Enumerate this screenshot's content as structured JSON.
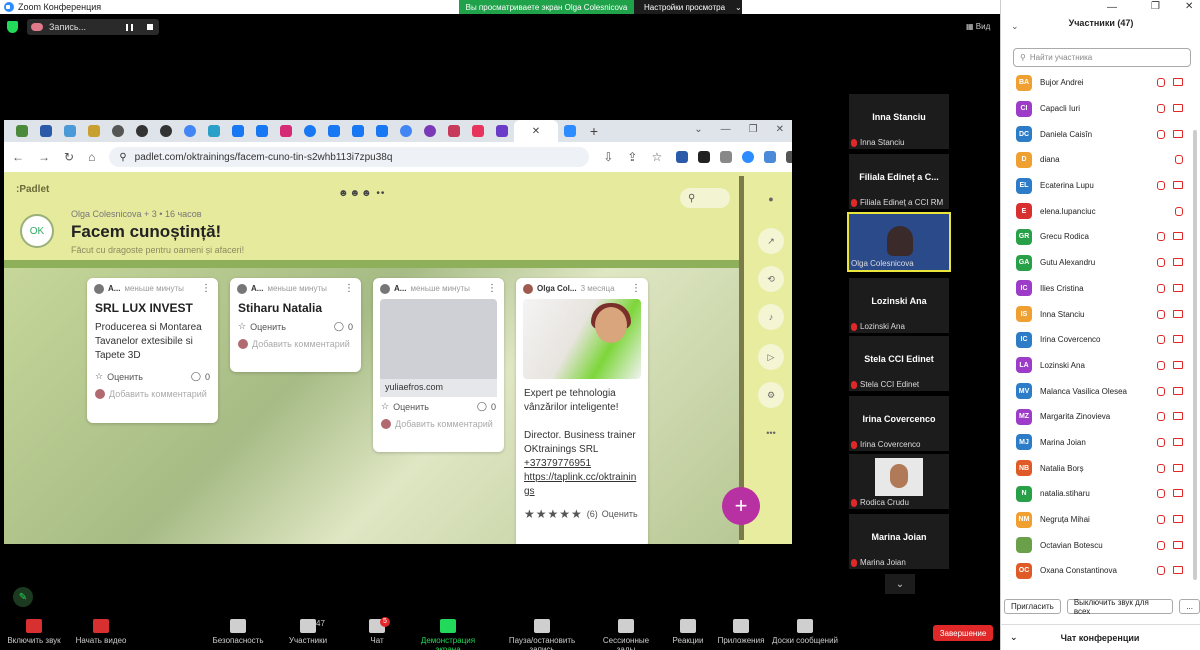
{
  "zoom": {
    "window_title": "Zoom Конференция",
    "rec_label": "Запись...",
    "share_banner": "Вы просматриваете экран Olga Colesnicova",
    "view_settings": "Настройки просмотра",
    "view_label": "Вид"
  },
  "browser": {
    "url": "padlet.com/oktrainings/facem-cuno-tin-s2whb113i7zpu38q"
  },
  "padlet": {
    "logo": ":Padlet",
    "author_meta": "Olga Colesnicova + 3 • 16 часов",
    "title": "Facem cunoștință!",
    "subtitle": "Făcut cu dragoste pentru oameni și afaceri!",
    "cards": [
      {
        "author": "А...",
        "time": "меньше минуты",
        "title": "SRL LUX INVEST",
        "body": "Producerea si Montarea Tavanelor extesibile si Tapete 3D",
        "rate": "Оценить",
        "comments": "0",
        "add_comment": "Добавить комментарий"
      },
      {
        "author": "А...",
        "time": "меньше минуты",
        "title": "Stiharu Natalia",
        "rate": "Оценить",
        "comments": "0",
        "add_comment": "Добавить комментарий"
      },
      {
        "author": "А...",
        "time": "меньше минуты",
        "link": "yuliaefros.com",
        "rate": "Оценить",
        "comments": "0",
        "add_comment": "Добавить комментарий"
      },
      {
        "author": "Olga Col...",
        "time": "3 месяца",
        "body1": "Expert pe tehnologia vânzărilor inteligente!",
        "body2": "Director. Business trainer OKtrainings SRL",
        "phone": "+37379776951",
        "link": "https://taplink.cc/oktrainings",
        "rating_count": "(6)",
        "rate": "Оценить",
        "rating": 5
      }
    ]
  },
  "strip": [
    {
      "big": "Inna Stanciu",
      "label": "Inna Stanciu"
    },
    {
      "big": "Filiala Edineț a C...",
      "label": "Filiala Edineț a CCI RM"
    },
    {
      "label": "Olga Colesnicova"
    },
    {
      "big": "Lozinski Ana",
      "label": "Lozinski Ana"
    },
    {
      "big": "Stela CCI Edinet",
      "label": "Stela CCI Edinet"
    },
    {
      "big": "Irina Covercenco",
      "label": "Irina Covercenco"
    },
    {
      "label": "Rodica Crudu"
    },
    {
      "big": "Marina Joian",
      "label": "Marina Joian"
    }
  ],
  "toolbar": {
    "mute": "Включить звук",
    "video": "Начать видео",
    "security": "Безопасность",
    "participants": "Участники",
    "participants_count": "47",
    "chat": "Чат",
    "chat_badge": "5",
    "share": "Демонстрация экрана",
    "pause": "Пауза/остановить запись",
    "breakout": "Сессионные залы",
    "reactions": "Реакции",
    "apps": "Приложения",
    "whiteboards": "Доски сообщений",
    "end": "Завершение"
  },
  "panel": {
    "title": "Участники (47)",
    "search_placeholder": "Найти участника",
    "invite": "Пригласить",
    "mute_all": "Выключить звук для всех",
    "more": "...",
    "chat_title": "Чат конференции",
    "participants": [
      {
        "initials": "BA",
        "name": "Bujor Andrei",
        "color": "#f0a030",
        "video": true
      },
      {
        "initials": "CI",
        "name": "Capacli Iuri",
        "color": "#9c3cc8",
        "video": true
      },
      {
        "initials": "DC",
        "name": "Daniela Caisîn",
        "color": "#2d7cc8",
        "video": true
      },
      {
        "initials": "D",
        "name": "diana",
        "color": "#f0a030",
        "video": false
      },
      {
        "initials": "EL",
        "name": "Ecaterina Lupu",
        "color": "#2d7cc8",
        "video": true
      },
      {
        "initials": "E",
        "name": "elena.lupanciuc",
        "color": "#d83030",
        "video": false
      },
      {
        "initials": "GR",
        "name": "Grecu Rodica",
        "color": "#28a048",
        "video": true
      },
      {
        "initials": "GA",
        "name": "Gutu Alexandru",
        "color": "#28a048",
        "video": true
      },
      {
        "initials": "IC",
        "name": "Ilies Cristina",
        "color": "#9c3cc8",
        "video": true
      },
      {
        "initials": "IS",
        "name": "Inna Stanciu",
        "color": "#f0a030",
        "video": true
      },
      {
        "initials": "IC",
        "name": "Irina Covercenco",
        "color": "#2d7cc8",
        "video": true
      },
      {
        "initials": "LA",
        "name": "Lozinski Ana",
        "color": "#9c3cc8",
        "video": true
      },
      {
        "initials": "MV",
        "name": "Malanca Vasilica Olesea",
        "color": "#2d7cc8",
        "video": true
      },
      {
        "initials": "MZ",
        "name": "Margarita Zinovieva",
        "color": "#9c3cc8",
        "video": true
      },
      {
        "initials": "MJ",
        "name": "Marina Joian",
        "color": "#2d7cc8",
        "video": true
      },
      {
        "initials": "NB",
        "name": "Natalia Borș",
        "color": "#e05a28",
        "video": true
      },
      {
        "initials": "N",
        "name": "natalia.stiharu",
        "color": "#28a048",
        "video": true
      },
      {
        "initials": "NM",
        "name": "Negruța Mihai",
        "color": "#f0a030",
        "video": true
      },
      {
        "initials": "",
        "name": "Octavian Botescu",
        "color": "#6aa04a",
        "video": true
      },
      {
        "initials": "OC",
        "name": "Oxana Constantinova",
        "color": "#e05a28",
        "video": true
      }
    ]
  }
}
